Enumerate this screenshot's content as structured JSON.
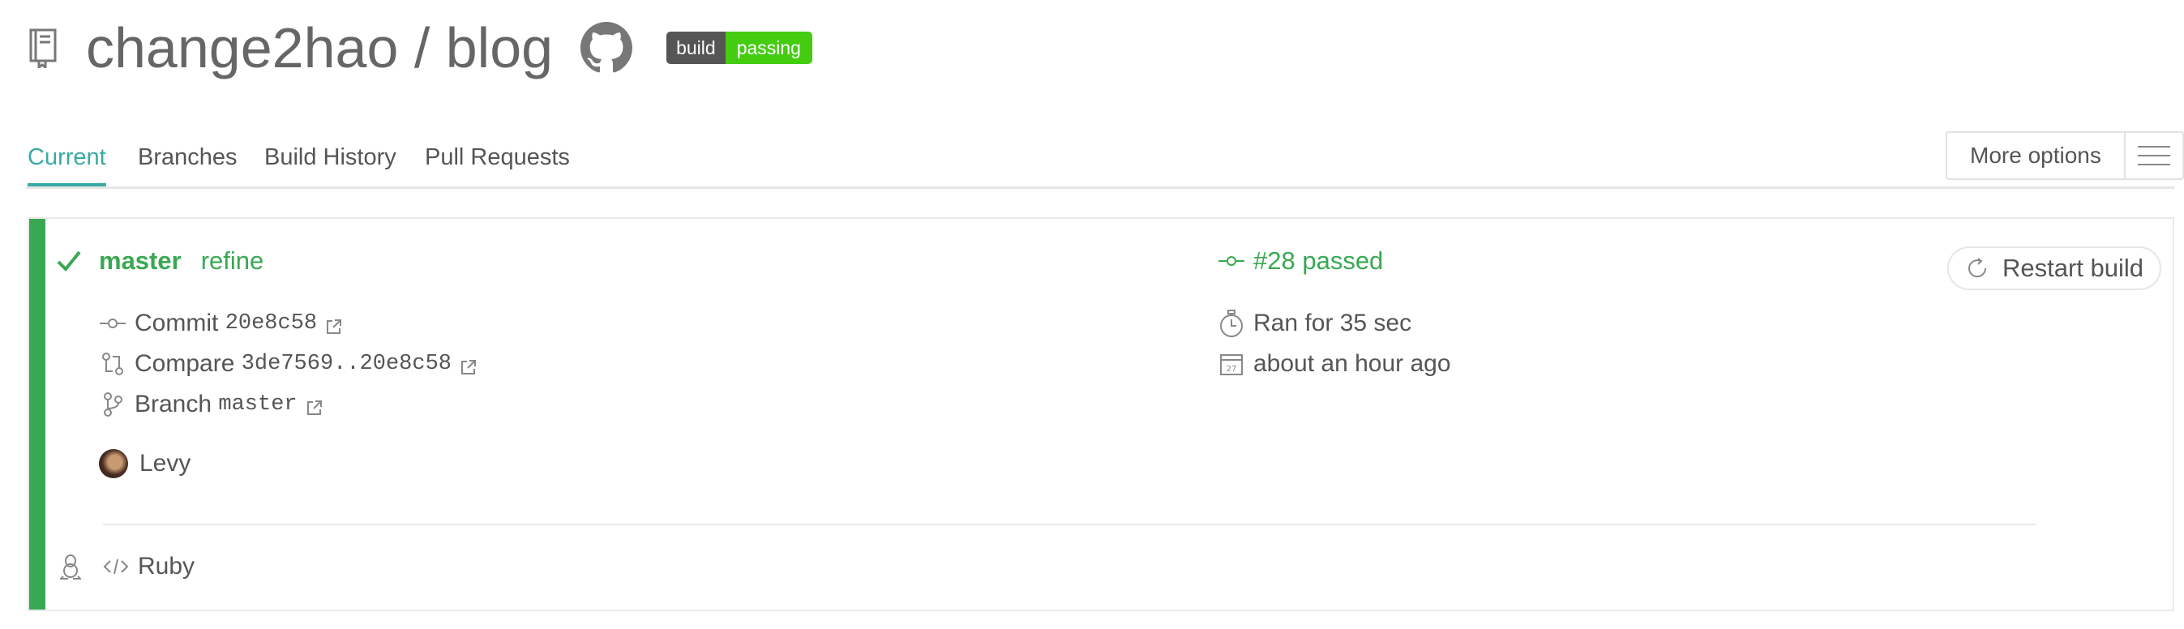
{
  "header": {
    "repo_icon": "repo-icon",
    "title": "change2hao / blog",
    "github_icon": "github-icon",
    "badge": {
      "left": "build",
      "right": "passing",
      "left_color": "#555555",
      "right_color": "#44cc11"
    }
  },
  "tabs": {
    "items": [
      {
        "label": "Current",
        "active": true
      },
      {
        "label": "Branches",
        "active": false
      },
      {
        "label": "Build History",
        "active": false
      },
      {
        "label": "Pull Requests",
        "active": false
      }
    ],
    "more_options_label": "More options",
    "menu_icon": "hamburger-icon",
    "active_color": "#39aaa4"
  },
  "build": {
    "status_color": "#39a852",
    "status_icon": "checkmark-icon",
    "branch": "master",
    "message": "refine",
    "commit_label": "Commit",
    "commit_sha": "20e8c58",
    "compare_label": "Compare",
    "compare_range": "3de7569..20e8c58",
    "branch_label": "Branch",
    "branch_name": "master",
    "author": "Levy",
    "build_number": "#28 passed",
    "duration": "Ran for 35 sec",
    "finished": "about an hour ago",
    "calendar_day": "27",
    "restart_label": "Restart build",
    "language": "Ruby",
    "os_icon": "linux-tux-icon"
  }
}
